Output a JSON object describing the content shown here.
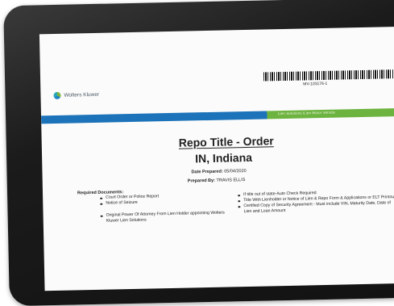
{
  "brand": {
    "name": "Wolters Kluwer"
  },
  "barcode": {
    "id": "MV-103176-1"
  },
  "banner": {
    "text": "Lien Solutions   iLien Motor Vehicle"
  },
  "document": {
    "title": "Repo Title - Order",
    "state": "IN, Indiana",
    "date_label": "Date Prepared:",
    "date_value": "05/04/2020",
    "prepared_label": "Prepared By:",
    "prepared_value": "TRAVIS ELLIS",
    "required_heading": "Required Documents:",
    "left_items": [
      "Court Order or Police Report",
      "Notice of Seizure",
      "Original Power Of Attorney From Lien Holder appointing Wolters Kluwer Lien Solutions"
    ],
    "right_items": [
      "If title out of state-Auto Check Required",
      "Title With Lienholder or Notice of Lien & Repo Form & Applications or ELT Printout",
      "Certified Copy of Security Agreement - Must include VIN, Maturity Date, Date of Lien and Loan Amount"
    ]
  }
}
